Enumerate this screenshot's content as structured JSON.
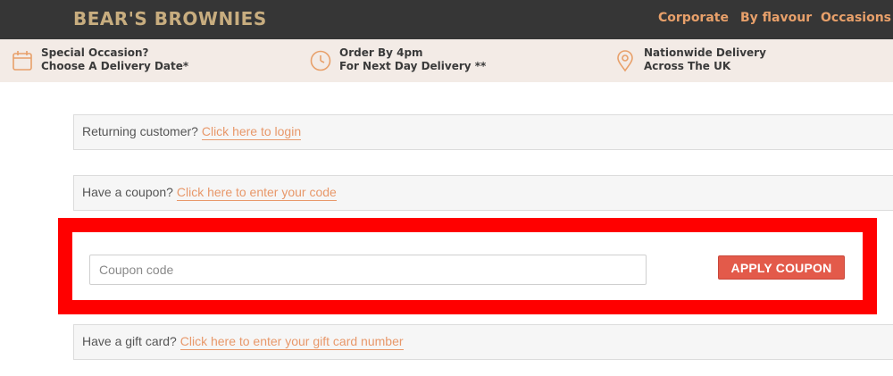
{
  "header": {
    "logo": "BEAR'S BROWNIES",
    "nav": [
      "Corporate",
      "By flavour",
      "Occasions"
    ]
  },
  "infobar": [
    {
      "icon": "calendar-icon",
      "line1": "Special Occasion?",
      "line2": "Choose A Delivery Date*"
    },
    {
      "icon": "clock-icon",
      "line1": "Order By 4pm",
      "line2": "For Next Day Delivery **"
    },
    {
      "icon": "location-pin-icon",
      "line1": "Nationwide Delivery",
      "line2": "Across The UK"
    }
  ],
  "notices": {
    "login": {
      "text": "Returning customer?",
      "link": "Click here to login"
    },
    "coupon": {
      "text": "Have a coupon?",
      "link": "Click here to enter your code"
    },
    "giftcard": {
      "text": "Have a gift card?",
      "link": "Click here to enter your gift card number"
    }
  },
  "coupon_form": {
    "placeholder": "Coupon code",
    "button_label": "APPLY COUPON"
  },
  "colors": {
    "header_bg": "#363636",
    "logo": "#c8ad7f",
    "nav": "#e8a06a",
    "infobar_bg": "#f3ebe6",
    "link": "#e8986a",
    "button": "#e35a4a",
    "highlight": "#ff0000"
  }
}
